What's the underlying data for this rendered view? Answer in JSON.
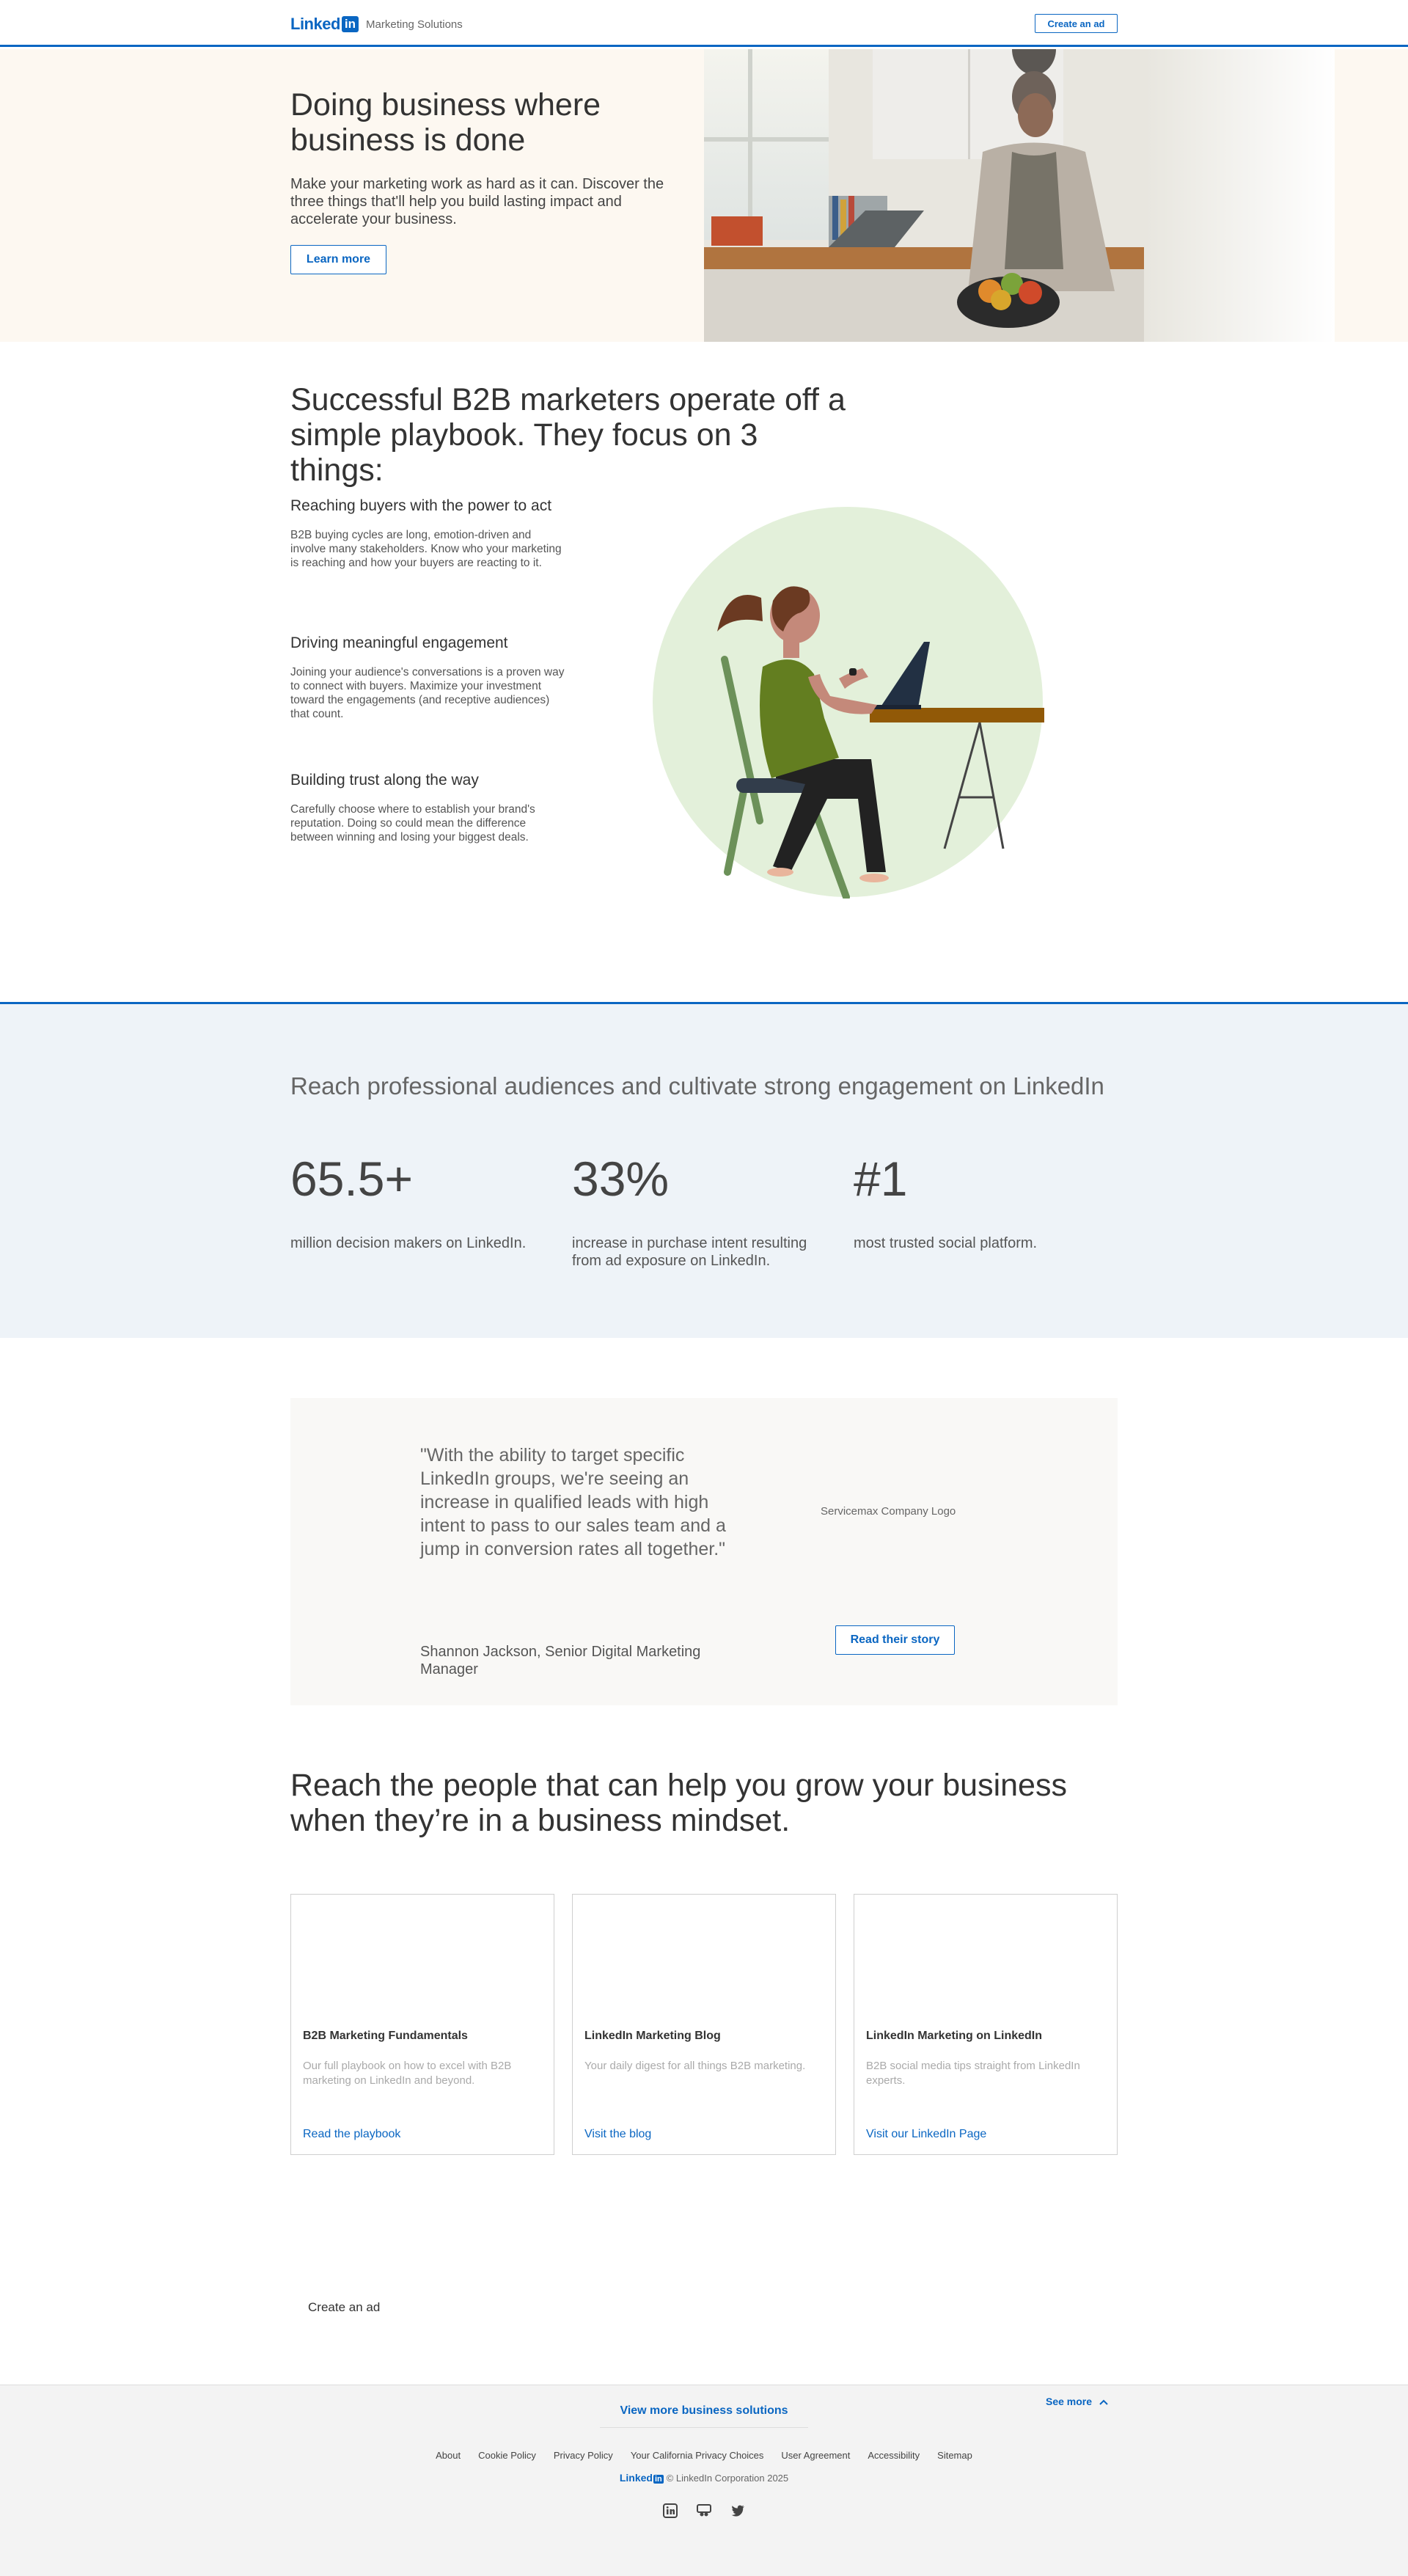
{
  "header": {
    "logo_text": "Linked",
    "logo_in": "in",
    "subtitle": "Marketing Solutions",
    "create_ad": "Create an ad"
  },
  "hero": {
    "title": "Doing business where business is done",
    "description": "Make your marketing work as hard as it can. Discover the three things that'll help you build lasting impact and accelerate your business.",
    "button": "Learn more"
  },
  "playbook": {
    "title": "Successful B2B marketers operate off a simple playbook. They focus on 3 things:",
    "items": [
      {
        "title": "Reaching buyers with the power to act",
        "body": "B2B buying cycles are long, emotion-driven and involve many stakeholders. Know who your marketing is reaching and how your buyers are reacting to it."
      },
      {
        "title": "Driving meaningful engagement",
        "body": "Joining your audience's conversations is a proven way to connect with buyers. Maximize your investment toward the engagements (and receptive audiences) that count."
      },
      {
        "title": "Building trust along the way",
        "body": "Carefully choose where to establish your brand's reputation. Doing so could mean the difference between winning and losing your biggest deals."
      }
    ]
  },
  "stats": {
    "title": "Reach professional audiences and cultivate strong engagement on LinkedIn",
    "items": [
      {
        "number": "65.5+",
        "label": "million decision makers on LinkedIn."
      },
      {
        "number": "33%",
        "label": "increase in purchase intent resulting from ad exposure on LinkedIn."
      },
      {
        "number": "#1",
        "label": "most trusted social platform."
      }
    ]
  },
  "testimonial": {
    "quote": "\"With the ability to target specific LinkedIn groups, we're seeing an increase in qualified leads with high intent to pass to our sales team and a jump in conversion rates all together.\"",
    "author": "Shannon Jackson, Senior Digital Marketing Manager",
    "logo_alt": "Servicemax Company Logo",
    "button": "Read their story"
  },
  "reach": {
    "title": "Reach the people that can help you grow your business when they’re in a business mindset.",
    "cards": [
      {
        "title": "B2B Marketing Fundamentals",
        "body": "Our full playbook on how to excel with B2B marketing on LinkedIn and beyond.",
        "link": "Read the playbook"
      },
      {
        "title": "LinkedIn Marketing Blog",
        "body": "Your daily digest for all things B2B marketing.",
        "link": "Visit the blog"
      },
      {
        "title": "LinkedIn Marketing on LinkedIn",
        "body": "B2B social media tips straight from LinkedIn experts.",
        "link": "Visit our LinkedIn Page"
      }
    ]
  },
  "bottom_create_ad": "Create an ad",
  "footer": {
    "view_more": "View more business solutions",
    "see_more": "See more",
    "links": [
      "About",
      "Cookie Policy",
      "Privacy Policy",
      "Your California Privacy Choices",
      "User Agreement",
      "Accessibility",
      "Sitemap"
    ],
    "copyright": "© LinkedIn Corporation 2025",
    "socials": [
      "linkedin-icon",
      "slideshare-icon",
      "twitter-icon"
    ]
  },
  "colors": {
    "brand": "#0a66c2",
    "hero_bg": "#fdf8f1",
    "stats_bg": "#eef3f8",
    "footer_bg": "#f3f3f3"
  }
}
